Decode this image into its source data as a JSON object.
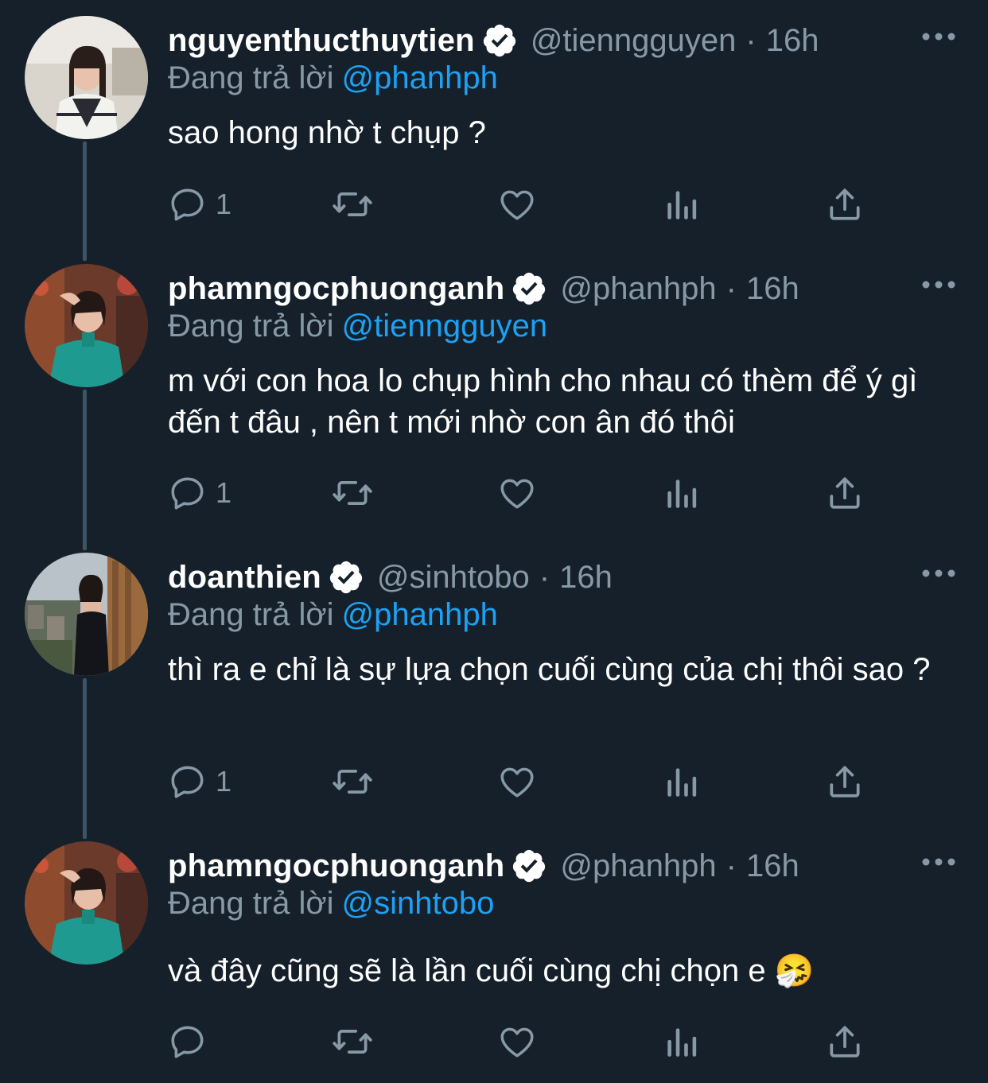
{
  "reply_prefix": "Đang trả lời",
  "colors": {
    "background": "#15202b",
    "text_primary": "#ffffff",
    "text_secondary": "#8899a6",
    "accent": "#1da1f2",
    "thread_line": "#3d5466"
  },
  "tweets": [
    {
      "display_name": "nguyenthucthuytien",
      "handle": "@tienngguyen",
      "separator": "·",
      "time": "16h",
      "reply_to": "@phanhph",
      "text": "sao hong nhờ t chụp ?",
      "reply_count": "1",
      "verified": true
    },
    {
      "display_name": "phamngocphuonganh",
      "handle": "@phanhph",
      "separator": "·",
      "time": "16h",
      "reply_to": "@tienngguyen",
      "text": "m với con hoa lo chụp hình cho nhau có thèm để ý gì đến t đâu , nên t mới nhờ con ân đó thôi",
      "reply_count": "1",
      "verified": true
    },
    {
      "display_name": "doanthien",
      "handle": "@sinhtobo",
      "separator": "·",
      "time": "16h",
      "reply_to": "@phanhph",
      "text": "thì ra e chỉ là sự lựa chọn cuối cùng của chị thôi sao ?",
      "reply_count": "1",
      "verified": true
    },
    {
      "display_name": "phamngocphuonganh",
      "handle": "@phanhph",
      "separator": "·",
      "time": "16h",
      "reply_to": "@sinhtobo",
      "text": "và đây cũng sẽ là lần cuối cùng chị chọn e 🤧",
      "reply_count": "",
      "verified": true
    }
  ],
  "icons": [
    "verified-badge-icon",
    "more-options-icon",
    "reply-icon",
    "retweet-icon",
    "like-icon",
    "analytics-icon",
    "share-icon"
  ]
}
